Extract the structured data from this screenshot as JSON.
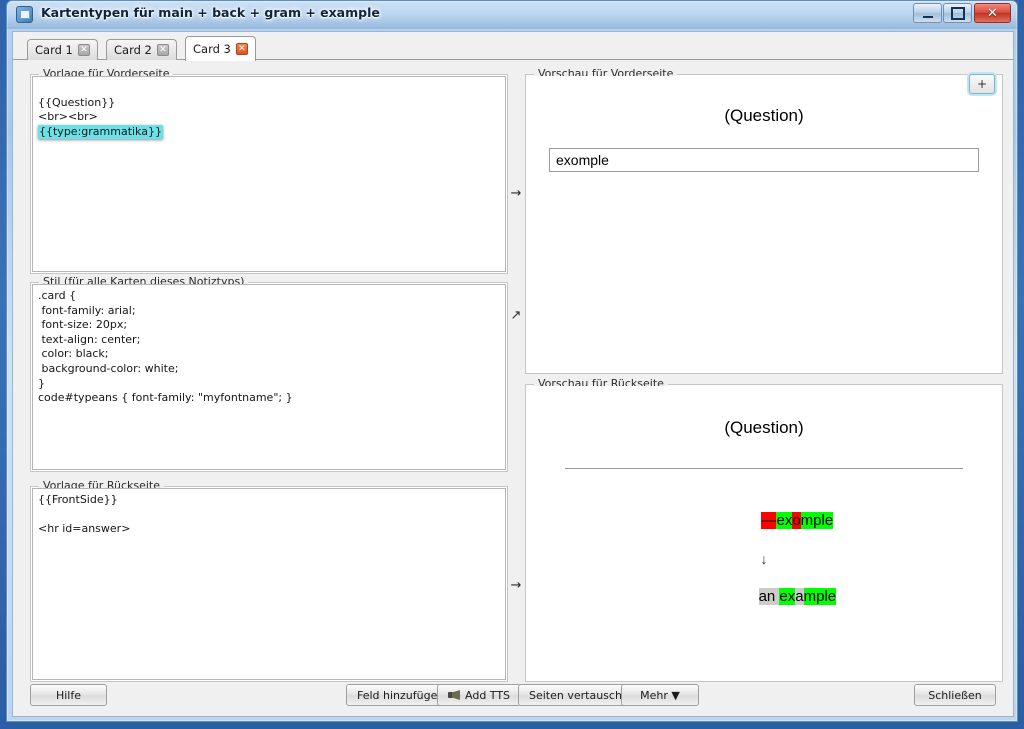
{
  "window": {
    "title": "Kartentypen für main + back + gram + example",
    "icon": "app-icon",
    "minimize_label": "",
    "maximize_label": "",
    "close_label": "✕"
  },
  "tabs": {
    "items": [
      {
        "label": "Card 1",
        "close": "✕",
        "active": false
      },
      {
        "label": "Card 2",
        "close": "✕",
        "active": false
      },
      {
        "label": "Card 3",
        "close": "✕",
        "active": true
      }
    ],
    "add_label": "+"
  },
  "left": {
    "front_group_label": "Vorlage für Vorderseite",
    "front_template_line1": "{{Question}}",
    "front_template_line2": "<br><br>",
    "front_template_line3": "{{type:grammatika}}",
    "style_group_label": "Stil (für alle Karten dieses Notiztyps)",
    "style_code": ".card {\n font-family: arial;\n font-size: 20px;\n text-align: center;\n color: black;\n background-color: white;\n}\ncode#typeans { font-family: \"myfontname\"; }",
    "back_group_label": "Vorlage für Rückseite",
    "back_template": "{{FrontSide}}\n\n<hr id=answer>"
  },
  "arrows": {
    "front_to_preview": "→",
    "style_up": "↗",
    "back_to_preview": "→"
  },
  "right": {
    "front_preview_label": "Vorschau für Vorderseite",
    "front_question": "(Question)",
    "front_input_value": "exomple",
    "back_preview_label": "Vorschau für Rückseite",
    "back_question": "(Question)",
    "diff_arrow": "↓",
    "diff_typed": [
      {
        "text": "—",
        "style": "red"
      },
      {
        "text": "ex",
        "style": "green"
      },
      {
        "text": "o",
        "style": "red"
      },
      {
        "text": "mple",
        "style": "green"
      }
    ],
    "diff_correct": [
      {
        "text": "an ",
        "style": "gray"
      },
      {
        "text": "ex",
        "style": "green"
      },
      {
        "text": "a",
        "style": "gray"
      },
      {
        "text": "mple",
        "style": "green"
      }
    ]
  },
  "buttons": {
    "help": "Hilfe",
    "add_field": "Feld hinzufügen",
    "add_tts": "Add TTS",
    "swap_sides": "Seiten vertauschen",
    "more": "Mehr ▼",
    "close": "Schließen"
  },
  "colors": {
    "selection_cyan": "#68e2e8",
    "diff_red": "#ff0000",
    "diff_green": "#00ff00",
    "diff_gray": "#cccccc",
    "active_tab_close": "#d9542a",
    "aero_blue": "#2f62a8"
  }
}
